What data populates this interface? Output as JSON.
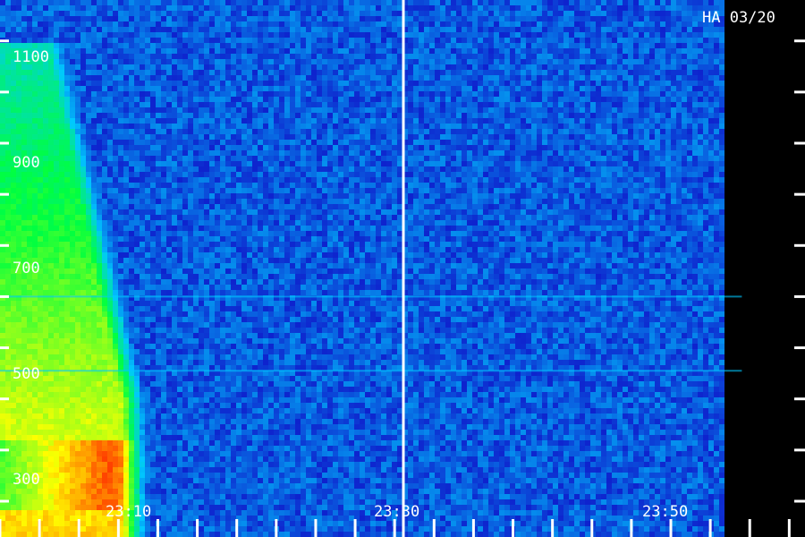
{
  "chart_data": {
    "type": "heatmap",
    "title": "HA 03/20",
    "ylabel": "",
    "xlabel": "",
    "y_tick_labels": [
      "1100",
      "900",
      "700",
      "500",
      "300"
    ],
    "y_tick_values": [
      1100,
      900,
      700,
      500,
      300
    ],
    "ylim": [
      230,
      1280
    ],
    "x_tick_labels": [
      "23:10",
      "23:30",
      "23:50"
    ],
    "x_tick_values": [
      "23:10",
      "23:30",
      "23:50"
    ],
    "xlim": [
      "23:05",
      "23:56"
    ],
    "colormap": [
      "#000060",
      "#1010c8",
      "#00c8ff",
      "#00ff40",
      "#ffff00",
      "#ff2000"
    ],
    "burst": {
      "end_time": "23:15",
      "freq_range": [
        260,
        1200
      ],
      "peak_freq_range": [
        280,
        420
      ],
      "peak_level": 0.92
    },
    "data_gap": {
      "start_time": "23:30",
      "end_time": "23:30"
    },
    "no_data_after": "23:52",
    "persistent_lines_freq": [
      555,
      700
    ]
  }
}
